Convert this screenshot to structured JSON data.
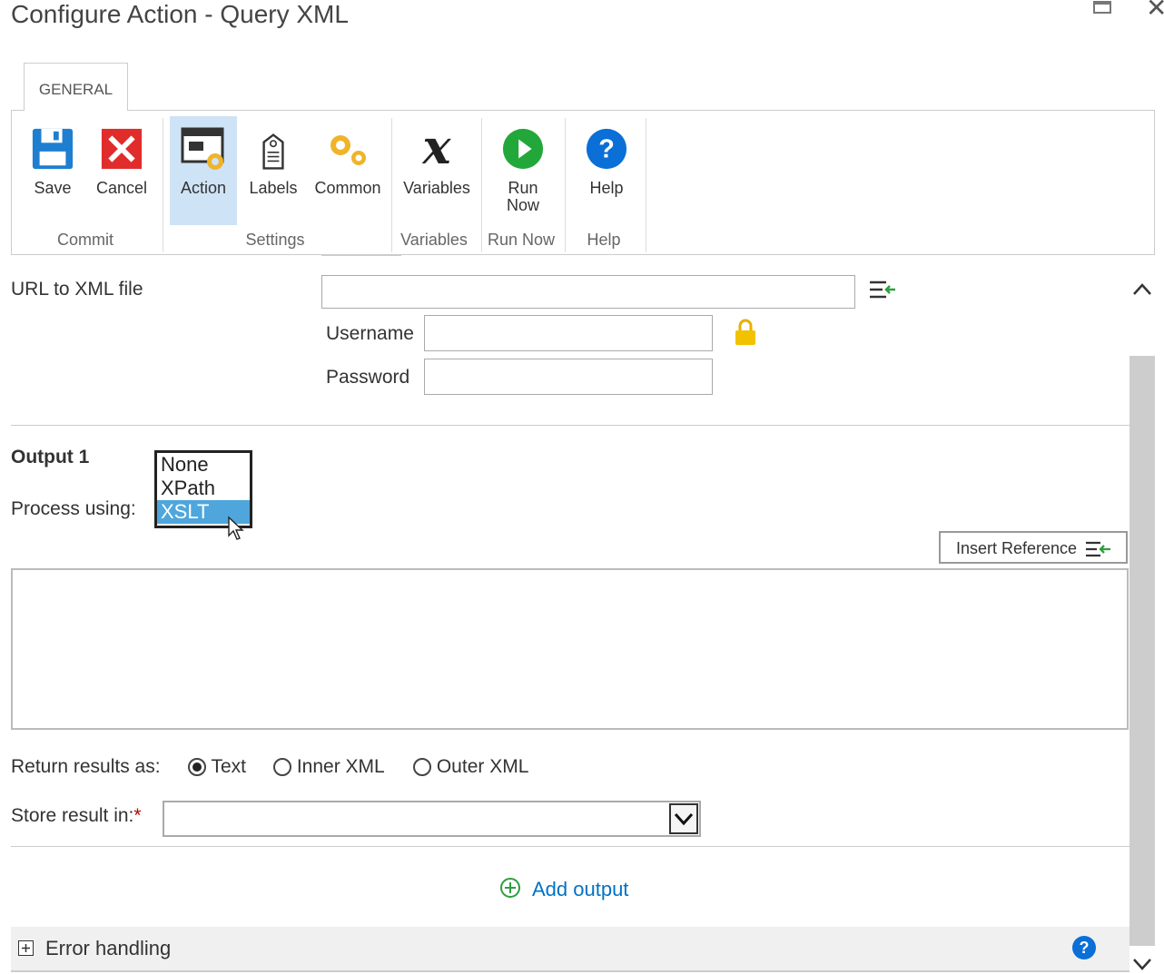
{
  "window": {
    "title": "Configure Action - Query XML"
  },
  "ribbon": {
    "tab": "GENERAL",
    "buttons": {
      "save": "Save",
      "cancel": "Cancel",
      "action": "Action",
      "labels": "Labels",
      "common": "Common",
      "variables": "Variables",
      "run_now_1": "Run",
      "run_now_2": "Now",
      "help": "Help"
    },
    "groups": {
      "commit": "Commit",
      "settings": "Settings",
      "variables": "Variables",
      "run_now": "Run Now",
      "help": "Help"
    }
  },
  "form": {
    "url_label": "URL to XML file",
    "url_value": "",
    "username_label": "Username",
    "username_value": "",
    "password_label": "Password",
    "password_value": ""
  },
  "output": {
    "heading": "Output 1",
    "process_label": "Process using:",
    "process_options": [
      "None",
      "XPath",
      "XSLT"
    ],
    "process_selected": "XSLT",
    "insert_reference": "Insert Reference",
    "query_value": "",
    "return_label": "Return results as:",
    "return_options": [
      "Text",
      "Inner XML",
      "Outer XML"
    ],
    "return_selected": "Text",
    "store_label": "Store result in:",
    "required_mark": "*",
    "store_value": "",
    "add_output": "Add output"
  },
  "error_handling": {
    "label": "Error handling"
  },
  "colors": {
    "accent": "#0072c6",
    "selected": "#4ea6dc",
    "active_ribbon": "#cfe3f6",
    "add": "#2e9e3e",
    "required": "#c00000"
  }
}
